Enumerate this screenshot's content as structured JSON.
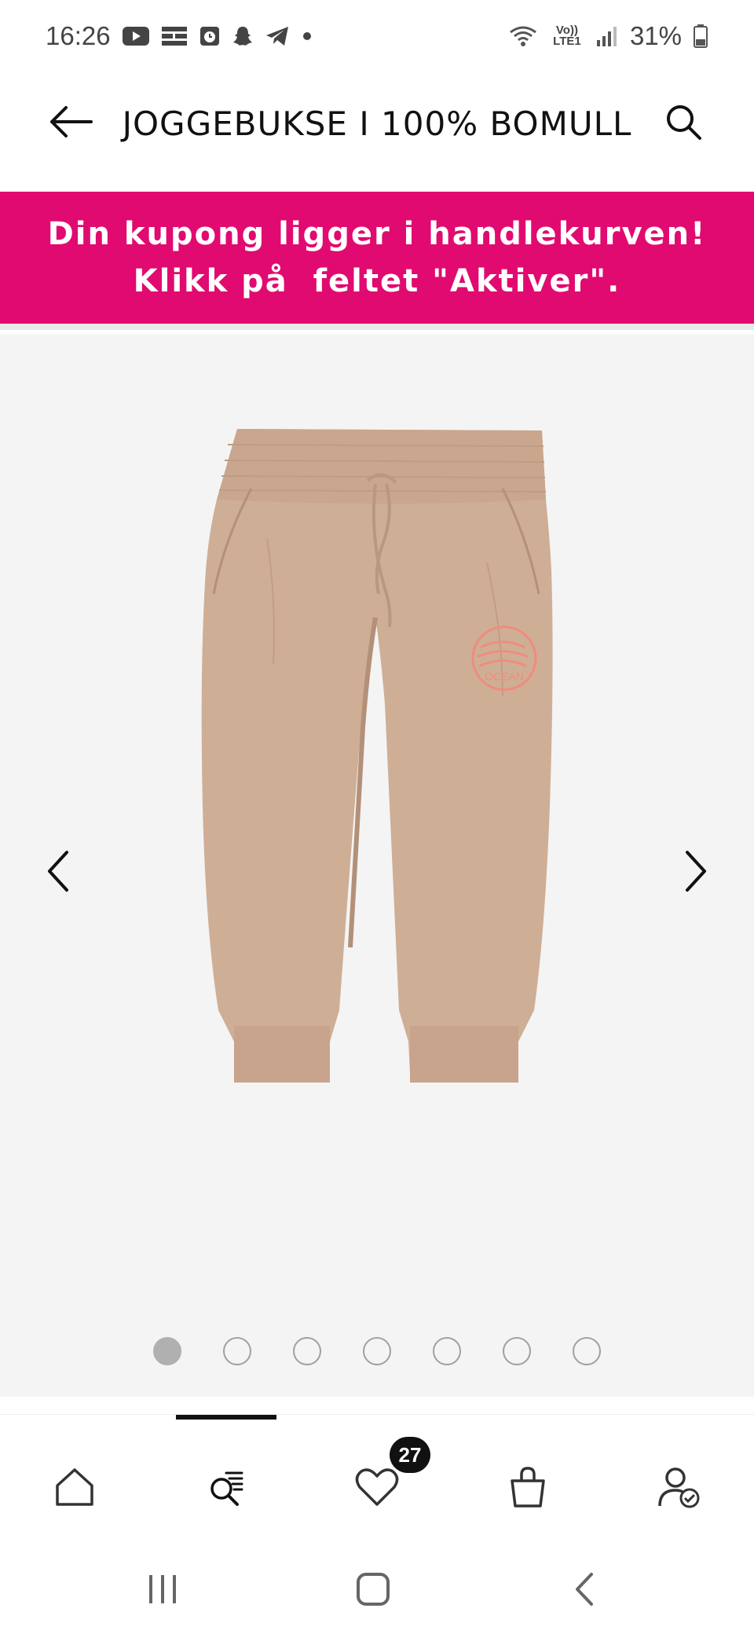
{
  "status_bar": {
    "time": "16:26",
    "battery": "31%",
    "network_label": "Vo)) LTE1",
    "left_icons": [
      "youtube-icon",
      "news-icon",
      "alarm-icon",
      "snapchat-icon",
      "telegram-icon",
      "dot-icon"
    ],
    "right_icons": [
      "wifi-icon",
      "volte-icon",
      "signal-icon",
      "battery-icon"
    ]
  },
  "header": {
    "title": "JOGGEBUKSE I 100% BOMULL",
    "back_icon": "arrow-left-icon",
    "search_icon": "search-icon"
  },
  "banner": {
    "line1": "Din kupong ligger i handlekurven!",
    "line2": "Klikk på  feltet \"Aktiver\".",
    "color": "#e10a70"
  },
  "product": {
    "image": "beige jogging pants with coral logo",
    "logo_text": "OCEAN",
    "colors": {
      "pants": "#cfae96",
      "logo": "#f08c7c",
      "background": "#f4f4f4"
    }
  },
  "gallery": {
    "image_count": 7,
    "active_index": 0,
    "prev_icon": "chevron-left-icon",
    "next_icon": "chevron-right-icon"
  },
  "bottom_nav": {
    "items": [
      "home-icon",
      "search-list-icon",
      "heart-icon",
      "shopping-bag-icon",
      "account-icon"
    ],
    "active_index": 1,
    "wishlist_count": "27"
  },
  "system_nav": [
    "recents-icon",
    "home-button-icon",
    "back-icon"
  ]
}
